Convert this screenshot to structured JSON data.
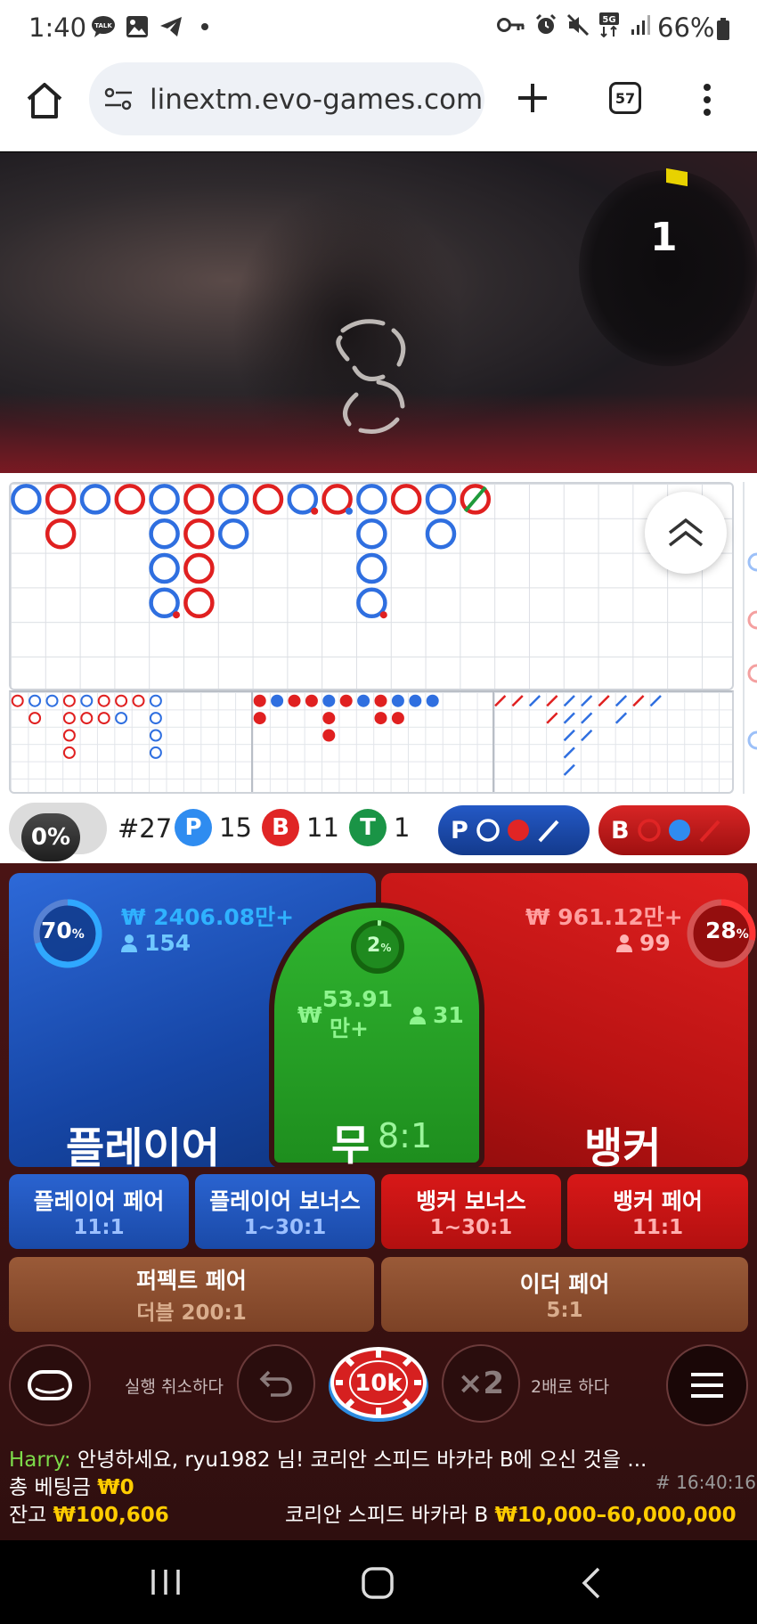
{
  "status": {
    "time": "1:40",
    "battery": "66%",
    "talk_label": "TALK",
    "signal_label": "5G"
  },
  "browser": {
    "url": "linextm.evo-games.com",
    "tab_count": "57"
  },
  "video": {
    "countdown": "1"
  },
  "roads": {
    "big_road": [
      [
        "P"
      ],
      [
        "B",
        "B"
      ],
      [
        "P"
      ],
      [
        "B"
      ],
      [
        "P",
        "P",
        "P",
        "P"
      ],
      [
        "B",
        "B",
        "B",
        "B"
      ],
      [
        "P",
        "P"
      ],
      [
        "B"
      ],
      [
        "P"
      ],
      [
        "B"
      ],
      [
        "P",
        "P",
        "P",
        "P"
      ],
      [
        "B"
      ],
      [
        "P",
        "P"
      ],
      [
        "B"
      ]
    ]
  },
  "stats": {
    "toggle": "0%",
    "round": "#27",
    "player_label": "P",
    "player_count": "15",
    "banker_label": "B",
    "banker_count": "11",
    "tie_label": "T",
    "tie_count": "1",
    "predict_player": "P",
    "predict_banker": "B"
  },
  "bets": {
    "player": {
      "label": "플레이어",
      "pct": "70",
      "pct_sign": "%",
      "amount": "₩ 2406.08만+",
      "users": "154"
    },
    "tie": {
      "label": "무",
      "odds": "8:1",
      "pct": "2",
      "pct_sign": "%",
      "amount_value": "53.91",
      "amount_unit": "만+",
      "currency": "₩",
      "users": "31"
    },
    "banker": {
      "label": "뱅커",
      "pct": "28",
      "pct_sign": "%",
      "amount": "₩ 961.12만+",
      "users": "99"
    },
    "player_pair": {
      "label": "플레이어 페어",
      "odds": "11:1"
    },
    "player_bonus": {
      "label": "플레이어 보너스",
      "odds": "1~30:1"
    },
    "banker_bonus": {
      "label": "뱅커 보너스",
      "odds": "1~30:1"
    },
    "banker_pair": {
      "label": "뱅커 페어",
      "odds": "11:1"
    },
    "perfect_pair": {
      "label": "퍼펙트 페어",
      "odds": "더블 200:1"
    },
    "either_pair": {
      "label": "이더 페어",
      "odds": "5:1"
    }
  },
  "controls": {
    "undo_label": "실행 취소하다",
    "chip_value": "10k",
    "double_icon": "×2",
    "double_label": "2배로 하다"
  },
  "chat": {
    "user": "Harry:",
    "message": " 안녕하세요, ryu1982 님! 코리안 스피드 바카라 B에 오신 것을 ..."
  },
  "footer": {
    "total_bet_label": "총 베팅금",
    "total_bet_value": "₩0",
    "balance_label": "잔고",
    "balance_value": "₩100,606",
    "game_id": "# 16:40:16",
    "table_name": "코리안 스피드 바카라 B",
    "limits": "₩10,000–60,000,000"
  },
  "colors": {
    "player": "#2f6fe0",
    "banker": "#e02020",
    "tie": "#1f9a3a",
    "gold": "#ffcc00"
  }
}
